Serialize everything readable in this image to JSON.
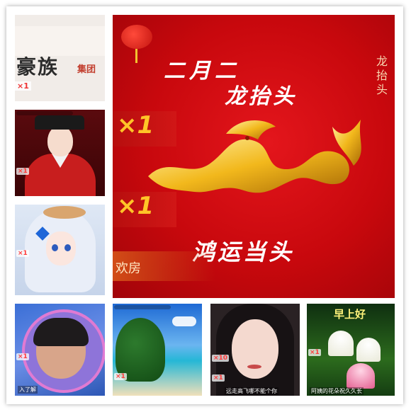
{
  "brand_tile": {
    "name_chars": "豪族",
    "suffix": "集团",
    "badge": "×1"
  },
  "portrait_tile": {
    "badge": "×1"
  },
  "anime_tile": {
    "badge": "×1"
  },
  "main_banner": {
    "heading_line1": "二月二",
    "heading_line2": "龙抬头",
    "side_text": "龙抬头",
    "blessing": "鸿运当头",
    "multiplier_1": "×1",
    "multiplier_2": "×1",
    "tag_text": "欢房"
  },
  "bottom_tiles": [
    {
      "badge": "×1",
      "caption": "入了解"
    },
    {
      "badge": "×1"
    },
    {
      "badge_top": "×10",
      "badge": "×1",
      "caption": "远走高飞哪不能个你"
    },
    {
      "greeting": "早上好",
      "badge": "×1",
      "caption": "阿姨的花朵祝久久长"
    }
  ],
  "colors": {
    "accent_red": "#c8080d",
    "gold": "#ffc528",
    "frame_bg": "#ffffff"
  }
}
